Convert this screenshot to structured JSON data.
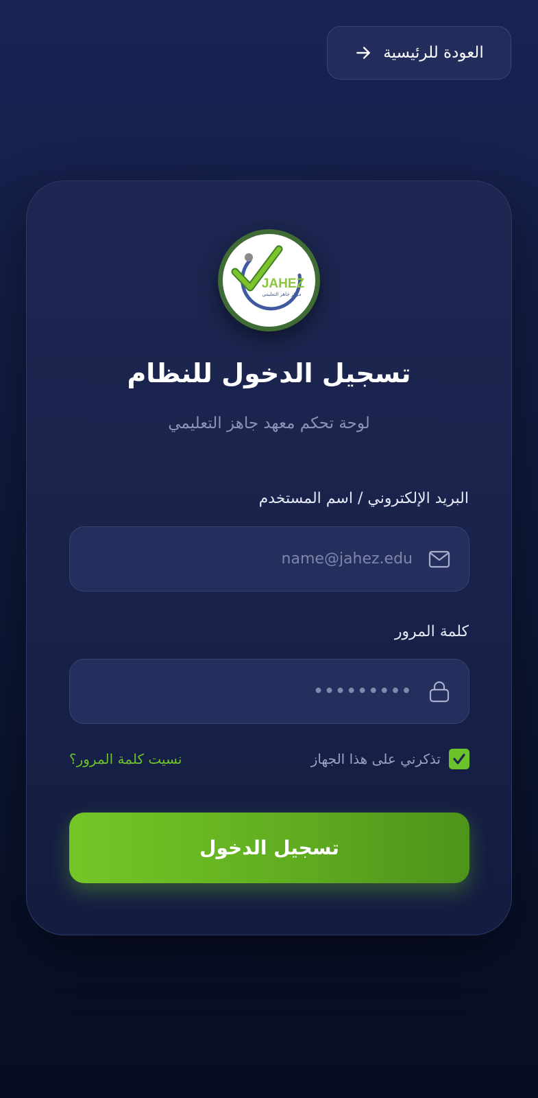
{
  "header": {
    "back_label": "العودة للرئيسية"
  },
  "brand": {
    "logo_text": "JAHEZ",
    "logo_tagline": "مركز جاهز التعليمي",
    "title": "تسجيل الدخول للنظام",
    "subtitle": "لوحة تحكم معهد جاهز التعليمي"
  },
  "form": {
    "email_label": "البريد الإلكتروني / اسم المستخدم",
    "email_placeholder": "name@jahez.edu",
    "password_label": "كلمة المرور",
    "password_value": "•••••••••",
    "remember_label": "تذكرني على هذا الجهاز",
    "remember_checked": true,
    "forgot_label": "نسيت كلمة المرور؟",
    "submit_label": "تسجيل الدخول"
  },
  "icons": {
    "back": "arrow-right-icon",
    "email": "mail-icon",
    "password": "lock-icon",
    "checkbox": "check-icon"
  },
  "colors": {
    "accent": "#6cc22b",
    "background": "#101a3c",
    "card": "#1b2550",
    "input": "#252f5e",
    "logo_ring": "#3f6b35"
  }
}
